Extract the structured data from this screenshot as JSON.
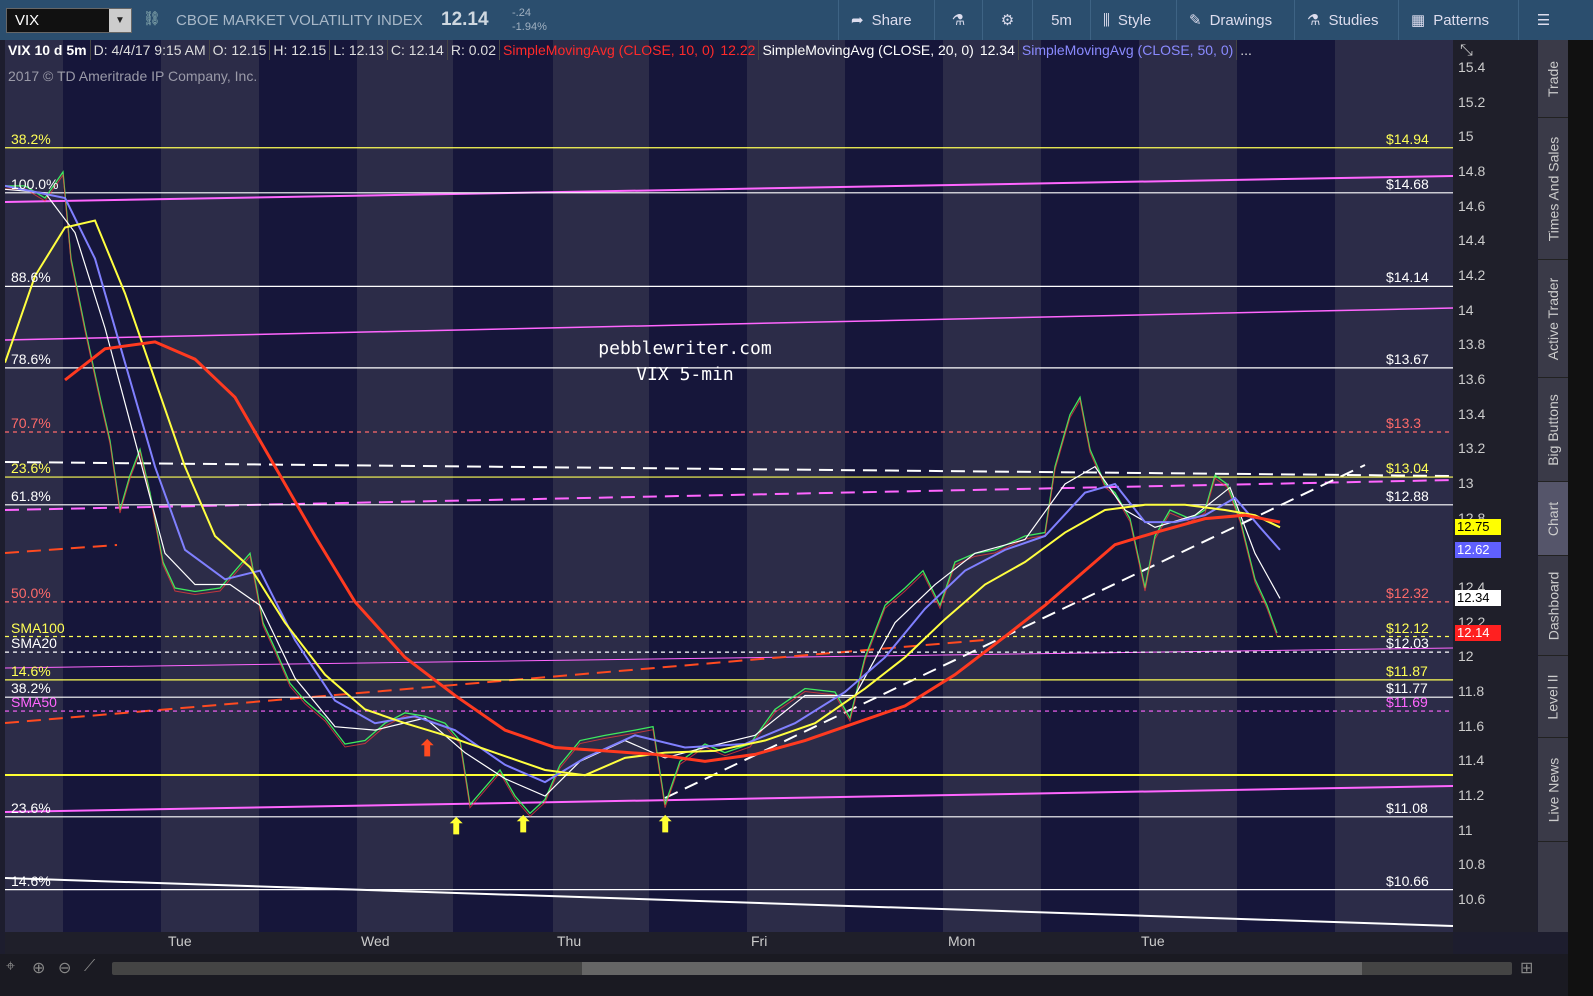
{
  "symbol_input": {
    "value": "VIX"
  },
  "security": {
    "name": "CBOE MARKET VOLATILITY INDEX",
    "price": "12.14",
    "change": "-.24",
    "change_pct": "-1.94%"
  },
  "toolbar": {
    "share": "Share",
    "timeframe": "5m",
    "style": "Style",
    "drawings": "Drawings",
    "studies": "Studies",
    "patterns": "Patterns"
  },
  "chart_header": {
    "title": "VIX 10 d 5m",
    "date": "D: 4/4/17 9:15 AM",
    "open": "O: 12.15",
    "high": "H: 12.15",
    "low": "L: 12.13",
    "close": "C: 12.14",
    "range": "R: 0.02",
    "sma10": "SimpleMovingAvg (CLOSE, 10, 0)",
    "sma10_val": "12.22",
    "sma20": "SimpleMovingAvg (CLOSE, 20, 0)",
    "sma20_val": "12.34",
    "sma50": "SimpleMovingAvg (CLOSE, 50, 0)",
    "more": "..."
  },
  "copyright": "2017 © TD Ameritrade IP Company, Inc.",
  "watermark": {
    "line1": "pebblewriter.com",
    "line2": "VIX 5-min"
  },
  "colors": {
    "sma10": "#ff3030",
    "sma20": "#ffffff",
    "sma50": "#8080ff",
    "fib_yellow": "#ffff55",
    "fib_white": "#ffffff",
    "magenta": "#ff66ff",
    "orange": "#ff5a2a"
  },
  "right_tabs": [
    "Trade",
    "Times And Sales",
    "Active Trader",
    "Big Buttons",
    "Chart",
    "Dashboard",
    "Level II",
    "Live News"
  ],
  "chart_data": {
    "type": "line",
    "title": "VIX 10 d 5m",
    "ylim": [
      10.45,
      15.5
    ],
    "yticks": [
      "15.4",
      "15.2",
      "15",
      "14.8",
      "14.6",
      "14.4",
      "14.2",
      "14",
      "13.8",
      "13.6",
      "13.4",
      "13.2",
      "13",
      "12.8",
      "12.6",
      "12.4",
      "12.2",
      "12",
      "11.8",
      "11.6",
      "11.4",
      "11.2",
      "11",
      "10.8",
      "10.6"
    ],
    "xticks": [
      "Tue",
      "Wed",
      "Thu",
      "Fri",
      "Mon",
      "Tue"
    ],
    "price_badges": [
      {
        "label": "12.75",
        "value": 12.75,
        "color": "#ffff00",
        "text_color": "#000"
      },
      {
        "label": "12.62",
        "value": 12.62,
        "color": "#6060ff",
        "text_color": "#fff"
      },
      {
        "label": "12.34",
        "value": 12.34,
        "color": "#ffffff",
        "text_color": "#000"
      },
      {
        "label": "12.14",
        "value": 12.14,
        "color": "#ff2020",
        "text_color": "#fff"
      }
    ],
    "levels": [
      {
        "left": "38.2%",
        "right": "$14.94",
        "value": 14.94,
        "color": "#ffff55",
        "dash": false
      },
      {
        "left": "100.0%",
        "right": "$14.68",
        "value": 14.68,
        "color": "#ffffff",
        "dash": false
      },
      {
        "left": "88.6%",
        "right": "$14.14",
        "value": 14.14,
        "color": "#ffffff",
        "dash": false
      },
      {
        "left": "78.6%",
        "right": "$13.67",
        "value": 13.67,
        "color": "#ffffff",
        "dash": false
      },
      {
        "left": "70.7%",
        "right": "$13.3",
        "value": 13.3,
        "color": "#ff6a6a",
        "dash": true
      },
      {
        "left": "23.6%",
        "right": "$13.04",
        "value": 13.04,
        "color": "#ffff55",
        "dash": false
      },
      {
        "left": "61.8%",
        "right": "$12.88",
        "value": 12.88,
        "color": "#ffffff",
        "dash": false
      },
      {
        "left": "50.0%",
        "right": "$12.32",
        "value": 12.32,
        "color": "#ff6a6a",
        "dash": true
      },
      {
        "left": "SMA100",
        "right": "$12.12",
        "value": 12.12,
        "color": "#ffff55",
        "dash": true
      },
      {
        "left": "SMA20",
        "right": "$12.03",
        "value": 12.03,
        "color": "#ffffff",
        "dash": true
      },
      {
        "left": "14.6%",
        "right": "$11.87",
        "value": 11.87,
        "color": "#ffff55",
        "dash": false
      },
      {
        "left": "38.2%",
        "right": "$11.77",
        "value": 11.77,
        "color": "#ffffff",
        "dash": false
      },
      {
        "left": "SMA50",
        "right": "$11.69",
        "value": 11.69,
        "color": "#ff66ff",
        "dash": true
      },
      {
        "left": "23.6%",
        "right": "$11.08",
        "value": 11.08,
        "color": "#ffffff",
        "dash": false
      },
      {
        "left": "14.6%",
        "right": "$10.66",
        "value": 10.66,
        "color": "#ffffff",
        "dash": false
      }
    ]
  }
}
